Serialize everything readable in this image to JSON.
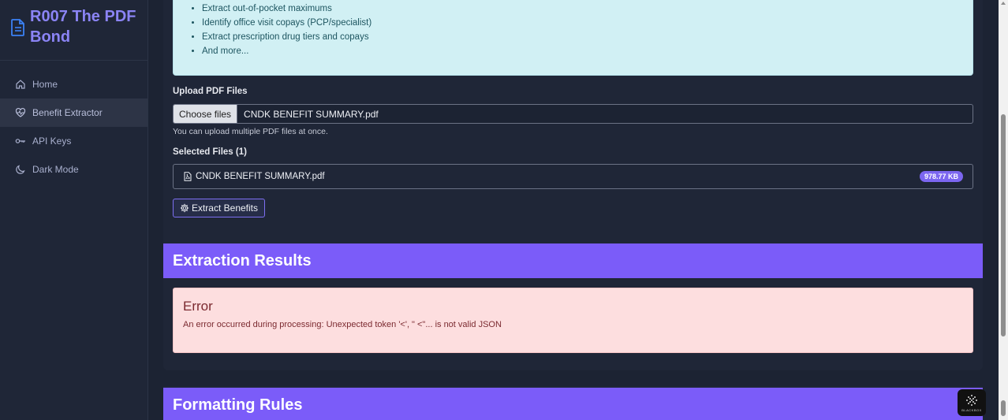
{
  "sidebar": {
    "brand_title": "R007 The PDF Bond",
    "items": [
      {
        "label": "Home",
        "icon": "home-icon"
      },
      {
        "label": "Benefit Extractor",
        "icon": "heart-pulse-icon",
        "active": true
      },
      {
        "label": "API Keys",
        "icon": "key-icon"
      },
      {
        "label": "Dark Mode",
        "icon": "moon-icon"
      }
    ]
  },
  "info": {
    "items": [
      "Extract out-of-pocket maximums",
      "Identify office visit copays (PCP/specialist)",
      "Extract prescription drug tiers and copays",
      "And more..."
    ]
  },
  "upload": {
    "label": "Upload PDF Files",
    "choose_button": "Choose files",
    "file_name": "CNDK BENEFIT SUMMARY.pdf",
    "help": "You can upload multiple PDF files at once."
  },
  "selected": {
    "label": "Selected Files (1)",
    "files": [
      {
        "name": "CNDK BENEFIT SUMMARY.pdf",
        "size": "978.77 KB"
      }
    ]
  },
  "extract_button": "Extract Benefits",
  "results": {
    "header": "Extraction Results",
    "error_title": "Error",
    "error_message": "An error occurred during processing: Unexpected token '<', \" <\"... is not valid JSON"
  },
  "formatting": {
    "header": "Formatting Rules"
  },
  "widget": {
    "label": "BLACKBOX"
  },
  "colors": {
    "accent": "#7b5cf9",
    "brand": "#8b84f5",
    "error_bg": "#fddedf",
    "info_bg": "#d1f0f4"
  }
}
